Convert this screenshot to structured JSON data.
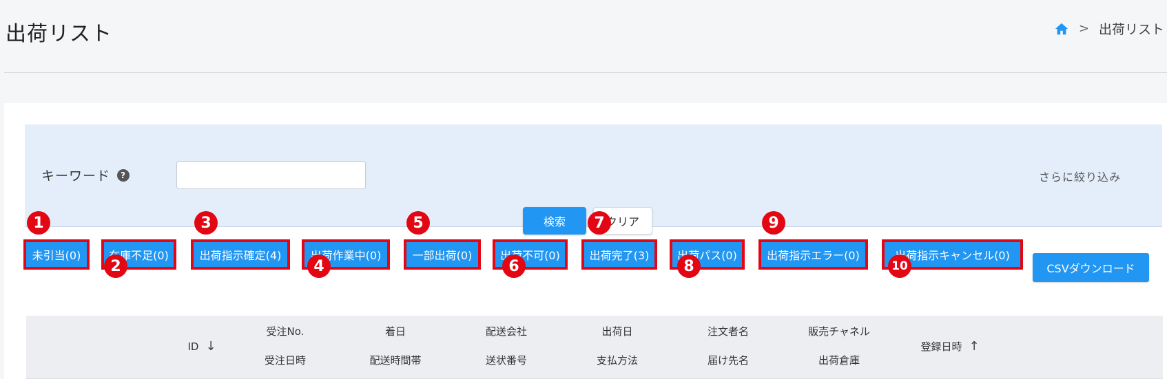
{
  "header": {
    "title": "出荷リスト",
    "breadcrumb": {
      "separator": ">",
      "current": "出荷リスト"
    }
  },
  "search": {
    "keyword_label": "キーワード",
    "help_glyph": "?",
    "keyword_value": "",
    "more_filters": "さらに絞り込み",
    "search_button": "検索",
    "clear_button": "クリア"
  },
  "status_buttons": [
    {
      "label": "未引当(0)",
      "badge": "1"
    },
    {
      "label": "在庫不足(0)",
      "badge": "2"
    },
    {
      "label": "出荷指示確定(4)",
      "badge": "3"
    },
    {
      "label": "出荷作業中(0)",
      "badge": "4"
    },
    {
      "label": "一部出荷(0)",
      "badge": "5"
    },
    {
      "label": "出荷不可(0)",
      "badge": "6"
    },
    {
      "label": "出荷完了(3)",
      "badge": "7"
    },
    {
      "label": "出荷パス(0)",
      "badge": "8"
    },
    {
      "label": "出荷指示エラー(0)",
      "badge": "9"
    },
    {
      "label": "出荷指示キャンセル(0)",
      "badge": "10"
    }
  ],
  "csv_button": "CSVダウンロード",
  "table": {
    "columns": {
      "id": "ID",
      "id_sort": "↓",
      "order_no": "受注No.",
      "order_date": "受注日時",
      "arrival_date": "着日",
      "delivery_time": "配送時間帯",
      "carrier": "配送会社",
      "tracking_no": "送状番号",
      "ship_date": "出荷日",
      "payment": "支払方法",
      "orderer": "注文者名",
      "recipient": "届け先名",
      "channel": "販売チャネル",
      "warehouse": "出荷倉庫",
      "created_at": "登録日時",
      "created_sort": "↑"
    }
  },
  "colors": {
    "primary": "#2196f3",
    "annotation_red": "#e30613",
    "panel_bg": "#e3eefa"
  }
}
